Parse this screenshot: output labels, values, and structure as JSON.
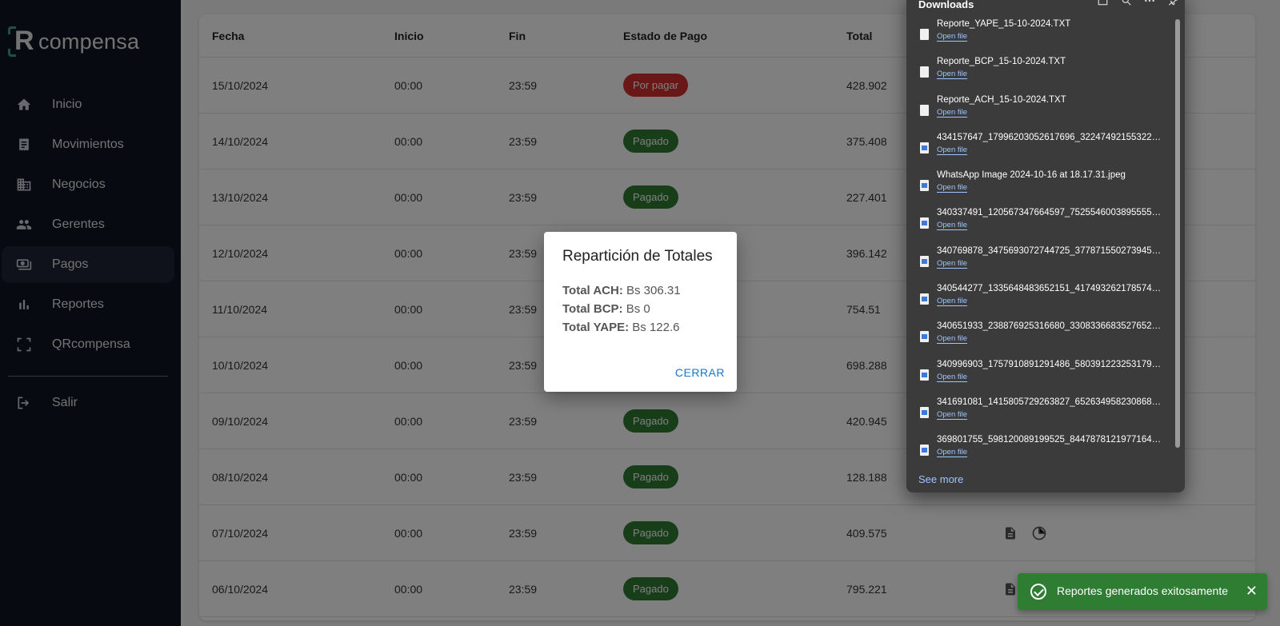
{
  "brand": {
    "logo_text": "compensa",
    "logo_letter": "R"
  },
  "sidebar": {
    "items": [
      {
        "label": "Inicio",
        "icon": "home-icon"
      },
      {
        "label": "Movimientos",
        "icon": "receipt-icon"
      },
      {
        "label": "Negocios",
        "icon": "building-icon"
      },
      {
        "label": "Gerentes",
        "icon": "people-icon"
      },
      {
        "label": "Pagos",
        "icon": "payments-icon",
        "active": true
      },
      {
        "label": "Reportes",
        "icon": "bar-chart-icon"
      },
      {
        "label": "QRcompensa",
        "icon": "qr-scan-icon"
      }
    ],
    "exit_label": "Salir"
  },
  "table": {
    "headers": {
      "fecha": "Fecha",
      "inicio": "Inicio",
      "fin": "Fin",
      "estado": "Estado de Pago",
      "total": "Total"
    },
    "rows": [
      {
        "fecha": "15/10/2024",
        "inicio": "00:00",
        "fin": "23:59",
        "estado": "Por pagar",
        "status": "pendiente",
        "total": "428.902"
      },
      {
        "fecha": "14/10/2024",
        "inicio": "00:00",
        "fin": "23:59",
        "estado": "Pagado",
        "status": "pagado",
        "total": "375.408"
      },
      {
        "fecha": "13/10/2024",
        "inicio": "00:00",
        "fin": "23:59",
        "estado": "Pagado",
        "status": "pagado",
        "total": "227.401"
      },
      {
        "fecha": "12/10/2024",
        "inicio": "00:00",
        "fin": "23:59",
        "estado": "Pagado",
        "status": "pagado",
        "total": "396.142"
      },
      {
        "fecha": "11/10/2024",
        "inicio": "00:00",
        "fin": "23:59",
        "estado": "Pagado",
        "status": "pagado",
        "total": "754.51"
      },
      {
        "fecha": "10/10/2024",
        "inicio": "00:00",
        "fin": "23:59",
        "estado": "Pagado",
        "status": "pagado",
        "total": "698.288"
      },
      {
        "fecha": "09/10/2024",
        "inicio": "00:00",
        "fin": "23:59",
        "estado": "Pagado",
        "status": "pagado",
        "total": "420.945"
      },
      {
        "fecha": "08/10/2024",
        "inicio": "00:00",
        "fin": "23:59",
        "estado": "Pagado",
        "status": "pagado",
        "total": "128.188"
      },
      {
        "fecha": "07/10/2024",
        "inicio": "00:00",
        "fin": "23:59",
        "estado": "Pagado",
        "status": "pagado",
        "total": "409.575"
      },
      {
        "fecha": "06/10/2024",
        "inicio": "00:00",
        "fin": "23:59",
        "estado": "Pagado",
        "status": "pagado",
        "total": "795.221"
      }
    ]
  },
  "dialog": {
    "title": "Repartición de Totales",
    "lines": [
      {
        "label": "Total ACH:",
        "value": "Bs 306.31"
      },
      {
        "label": "Total BCP:",
        "value": "Bs 0"
      },
      {
        "label": "Total YAPE:",
        "value": "Bs 122.6"
      }
    ],
    "button": "CERRAR"
  },
  "downloads": {
    "title": "Downloads",
    "open_file_label": "Open file",
    "see_more": "See more",
    "items": [
      {
        "name": "Reporte_YAPE_15-10-2024.TXT",
        "type": "text"
      },
      {
        "name": "Reporte_BCP_15-10-2024.TXT",
        "type": "text"
      },
      {
        "name": "Reporte_ACH_15-10-2024.TXT",
        "type": "text"
      },
      {
        "name": "434157647_1799620305261769​6_3224749215532295...",
        "type": "image"
      },
      {
        "name": "WhatsApp Image 2024-10-16 at 18.17.31.jpeg",
        "type": "image"
      },
      {
        "name": "340337491_120567347664597_752554600389555581_...",
        "type": "image"
      },
      {
        "name": "340769878_3475693072744725_37787155027394571...",
        "type": "image"
      },
      {
        "name": "340544277_1335648483652151_41749326217857447...",
        "type": "image"
      },
      {
        "name": "340651933_238876925316680_330833668352765249...",
        "type": "image"
      },
      {
        "name": "340996903_1757910891291486_58039122325317965...",
        "type": "image"
      },
      {
        "name": "341691081_1415805729263827_65263495823086824...",
        "type": "image"
      },
      {
        "name": "369801755_598120089199525_844787812197716478...",
        "type": "image"
      }
    ]
  },
  "toast": {
    "text": "Reportes generados exitosamente"
  }
}
